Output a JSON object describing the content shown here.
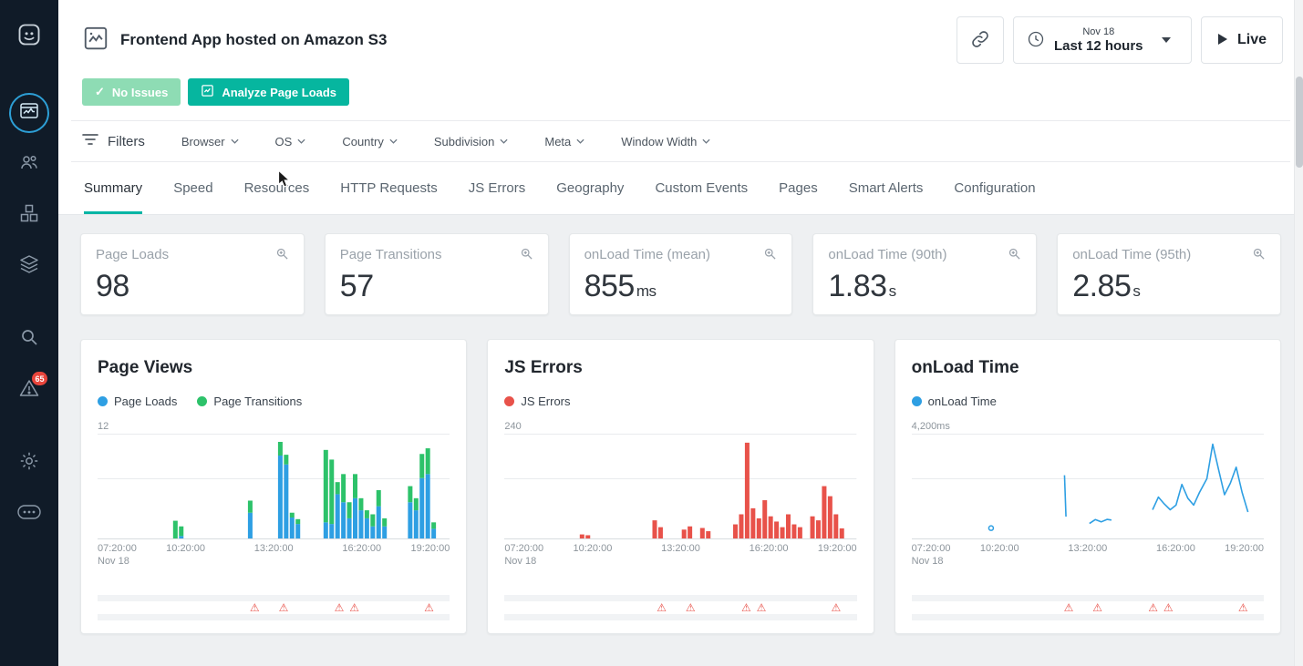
{
  "header": {
    "title": "Frontend App hosted on Amazon S3",
    "time_date": "Nov 18",
    "time_range": "Last 12 hours",
    "live": "Live"
  },
  "toolbar": {
    "no_issues": "No Issues",
    "analyze": "Analyze Page Loads"
  },
  "filters": {
    "label": "Filters",
    "dropdowns": [
      "Browser",
      "OS",
      "Country",
      "Subdivision",
      "Meta",
      "Window Width"
    ]
  },
  "tabs": [
    "Summary",
    "Speed",
    "Resources",
    "HTTP Requests",
    "JS Errors",
    "Geography",
    "Custom Events",
    "Pages",
    "Smart Alerts",
    "Configuration"
  ],
  "active_tab": "Summary",
  "sidebar": {
    "alert_badge": "65"
  },
  "icons": {
    "header": "chart-image-icon",
    "share": "link-icon",
    "time": "clock-icon",
    "live": "play-icon",
    "stat_corner": "zoom-icon",
    "alert_marker": "warning-triangle-icon"
  },
  "stats": [
    {
      "label": "Page Loads",
      "value": "98",
      "unit": ""
    },
    {
      "label": "Page Transitions",
      "value": "57",
      "unit": ""
    },
    {
      "label": "onLoad Time (mean)",
      "value": "855",
      "unit": "ms"
    },
    {
      "label": "onLoad Time (90th)",
      "value": "1.83",
      "unit": "s"
    },
    {
      "label": "onLoad Time (95th)",
      "value": "2.85",
      "unit": "s"
    }
  ],
  "chart_data": [
    {
      "type": "bar",
      "title": "Page Views",
      "legend": [
        {
          "label": "Page Loads",
          "color": "#2e9fe3"
        },
        {
          "label": "Page Transitions",
          "color": "#2dc26a"
        }
      ],
      "colors": [
        "#2e9fe3",
        "#2dc26a"
      ],
      "ymax": 12,
      "ymax_label": "12",
      "slots": 48,
      "x_ticks": [
        "07:20:00",
        "10:20:00",
        "13:20:00",
        "16:20:00",
        "19:20:00"
      ],
      "x_sub": "Nov 18",
      "bars": [
        [
          10.6,
          0,
          2.2
        ],
        [
          11.4,
          0.3,
          1.2
        ],
        [
          20.8,
          3.2,
          1.5
        ],
        [
          24.9,
          10.3,
          1.7
        ],
        [
          25.7,
          9.2,
          1.2
        ],
        [
          26.5,
          2.6,
          0.6
        ],
        [
          27.3,
          1.8,
          0.6
        ],
        [
          31.1,
          2.0,
          9.0
        ],
        [
          31.9,
          1.8,
          8.0
        ],
        [
          32.7,
          5.5,
          1.5
        ],
        [
          33.5,
          4.5,
          3.5
        ],
        [
          34.3,
          2.5,
          2.0
        ],
        [
          35.1,
          5.0,
          3.0
        ],
        [
          35.9,
          3.5,
          1.5
        ],
        [
          36.7,
          2.5,
          1.0
        ],
        [
          37.5,
          1.5,
          1.5
        ],
        [
          38.3,
          4.0,
          2.0
        ],
        [
          39.1,
          1.5,
          1.0
        ],
        [
          42.6,
          4.5,
          2.0
        ],
        [
          43.4,
          3.5,
          1.5
        ],
        [
          44.2,
          7.5,
          3.0
        ],
        [
          45.0,
          8.0,
          3.2
        ],
        [
          45.8,
          1.2,
          0.8
        ]
      ],
      "alerts": [
        0.446,
        0.528,
        0.686,
        0.729,
        0.941
      ]
    },
    {
      "type": "bar",
      "title": "JS Errors",
      "legend": [
        {
          "label": "JS Errors",
          "color": "#e8524a"
        }
      ],
      "colors": [
        "#e8524a"
      ],
      "ymax": 240,
      "ymax_label": "240",
      "slots": 48,
      "x_ticks": [
        "07:20:00",
        "10:20:00",
        "13:20:00",
        "16:20:00",
        "19:20:00"
      ],
      "x_sub": "Nov 18",
      "bars": [
        [
          10.6,
          10
        ],
        [
          11.4,
          8
        ],
        [
          20.5,
          45
        ],
        [
          21.3,
          28
        ],
        [
          24.5,
          22
        ],
        [
          25.3,
          30
        ],
        [
          27.0,
          26
        ],
        [
          27.8,
          18
        ],
        [
          31.5,
          35
        ],
        [
          32.3,
          60
        ],
        [
          33.1,
          238
        ],
        [
          33.9,
          75
        ],
        [
          34.7,
          50
        ],
        [
          35.5,
          95
        ],
        [
          36.3,
          55
        ],
        [
          37.1,
          42
        ],
        [
          37.9,
          28
        ],
        [
          38.7,
          60
        ],
        [
          39.5,
          35
        ],
        [
          40.3,
          28
        ],
        [
          42.0,
          55
        ],
        [
          42.8,
          45
        ],
        [
          43.6,
          130
        ],
        [
          44.4,
          105
        ],
        [
          45.2,
          60
        ],
        [
          46.0,
          25
        ]
      ],
      "alerts": [
        0.446,
        0.528,
        0.686,
        0.729,
        0.941
      ]
    },
    {
      "type": "line",
      "title": "onLoad Time",
      "legend": [
        {
          "label": "onLoad Time",
          "color": "#2e9fe3"
        }
      ],
      "colors": [
        "#2e9fe3"
      ],
      "ymax": 4200,
      "ymax_label": "4,200ms",
      "slots": 48,
      "x_ticks": [
        "07:20:00",
        "10:20:00",
        "13:20:00",
        "16:20:00",
        "19:20:00"
      ],
      "x_sub": "Nov 18",
      "segments": [
        [
          [
            20.8,
            2750
          ],
          [
            21.0,
            950
          ]
        ],
        [
          [
            24.2,
            650
          ],
          [
            25.0,
            820
          ],
          [
            25.8,
            720
          ],
          [
            26.6,
            830
          ],
          [
            27.2,
            800
          ]
        ],
        [
          [
            32.8,
            1250
          ],
          [
            33.6,
            1800
          ],
          [
            34.4,
            1500
          ],
          [
            35.2,
            1250
          ],
          [
            36.0,
            1450
          ],
          [
            36.8,
            2350
          ],
          [
            37.6,
            1750
          ],
          [
            38.4,
            1450
          ],
          [
            39.2,
            2000
          ],
          [
            40.2,
            2600
          ],
          [
            41.0,
            4100
          ],
          [
            41.8,
            3000
          ],
          [
            42.6,
            1900
          ],
          [
            43.4,
            2400
          ],
          [
            44.2,
            3100
          ],
          [
            45.0,
            2000
          ],
          [
            45.8,
            1150
          ]
        ]
      ],
      "dots": [
        [
          10.8,
          450
        ]
      ],
      "alerts": [
        0.446,
        0.528,
        0.686,
        0.729,
        0.941
      ]
    }
  ]
}
